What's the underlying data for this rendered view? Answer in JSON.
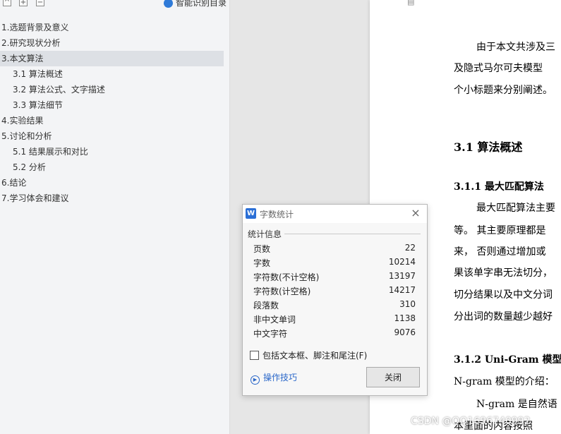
{
  "nav": {
    "toolbar": {
      "collapse": "^",
      "expand": "+",
      "minus": "−",
      "smart_toc": "智能识别目录"
    },
    "items": [
      {
        "label": "1.选题背景及意义",
        "level": 1,
        "active": false
      },
      {
        "label": "2.研究现状分析",
        "level": 1,
        "active": false
      },
      {
        "label": "3.本文算法",
        "level": 1,
        "active": true
      },
      {
        "label": "3.1  算法概述",
        "level": 2,
        "active": false
      },
      {
        "label": "3.2  算法公式、文字描述",
        "level": 2,
        "active": false
      },
      {
        "label": "3.3  算法细节",
        "level": 2,
        "active": false
      },
      {
        "label": "4.实验结果",
        "level": 1,
        "active": false
      },
      {
        "label": "5.讨论和分析",
        "level": 1,
        "active": false
      },
      {
        "label": "5.1 结果展示和对比",
        "level": 2,
        "active": false
      },
      {
        "label": "5.2 分析",
        "level": 2,
        "active": false
      },
      {
        "label": "6.结论",
        "level": 1,
        "active": false
      },
      {
        "label": "7.学习体会和建议",
        "level": 1,
        "active": false
      }
    ]
  },
  "document": {
    "p1": [
      "由于本文共涉及三",
      "及隐式马尔可夫模型",
      "个小标题来分别阐述。"
    ],
    "h_31": "3.1  算法概述",
    "h_311": "3.1.1  最大匹配算法",
    "p2": [
      "最大匹配算法主要",
      "等。 其主要原理都是",
      "来， 否则通过增加或",
      "果该单字串无法切分，",
      "切分结果以及中文分词",
      "分出词的数量越少越好"
    ],
    "h_312": "3.1.2 Uni-Gram 模型",
    "p3": [
      "N-gram 模型的介绍：",
      "N-gram 是自然语",
      "本里面的内容按照"
    ]
  },
  "dialog": {
    "logo": "W",
    "title": "字数统计",
    "close_icon": "×",
    "section": "统计信息",
    "stats": [
      {
        "key": "页数",
        "value": "22"
      },
      {
        "key": "字数",
        "value": "10214"
      },
      {
        "key": "字符数(不计空格)",
        "value": "13197"
      },
      {
        "key": "字符数(计空格)",
        "value": "14217"
      },
      {
        "key": "段落数",
        "value": "310"
      },
      {
        "key": "非中文单词",
        "value": "1138"
      },
      {
        "key": "中文字符",
        "value": "9076"
      }
    ],
    "checkbox_label": "包括文本框、脚注和尾注(F)",
    "checkbox_checked": false,
    "tips_label": "操作技巧",
    "close_button": "关闭"
  },
  "watermark": "CSDN @QQ1696740992"
}
